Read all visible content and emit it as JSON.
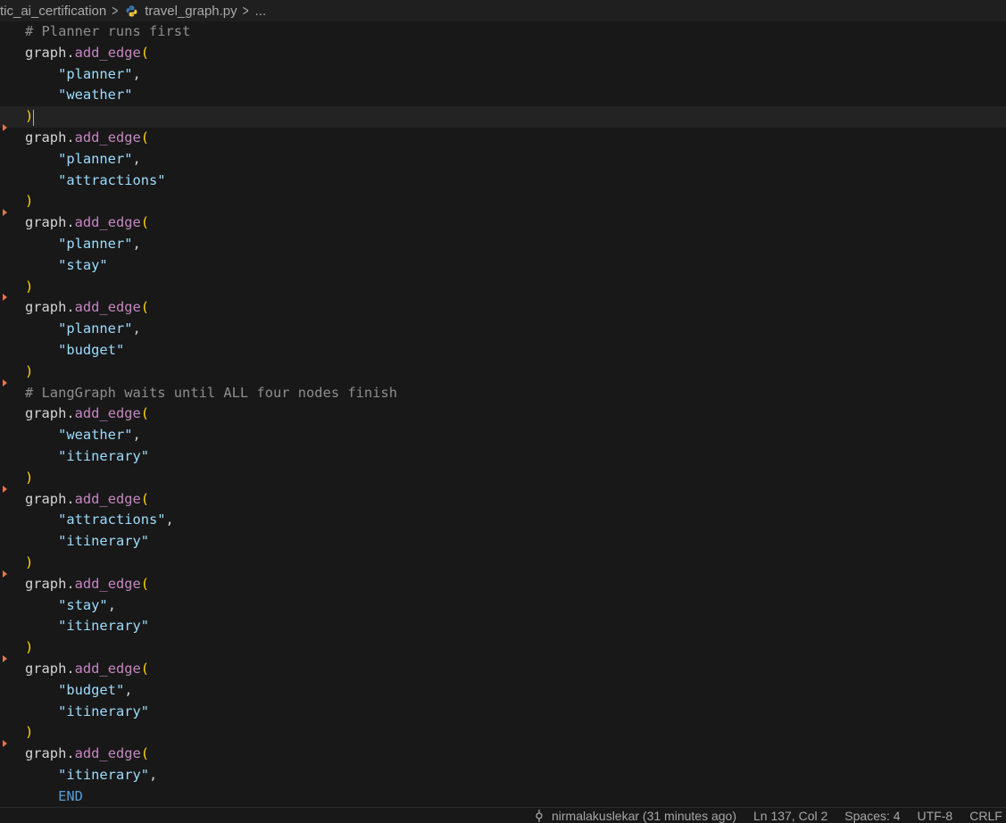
{
  "breadcrumb": {
    "folder": "tic_ai_certification",
    "file": "travel_graph.py",
    "more": "...",
    "file_icon": "python-icon",
    "separator_icon": "chevron-right-icon"
  },
  "editor": {
    "lines": [
      {
        "fold_arrow": false,
        "tokens": [
          {
            "t": "comment",
            "v": "# Planner runs first"
          }
        ]
      },
      {
        "fold_arrow": false,
        "tokens": [
          {
            "t": "var",
            "v": "graph"
          },
          {
            "t": "punct",
            "v": "."
          },
          {
            "t": "func",
            "v": "add_edge"
          },
          {
            "t": "paren",
            "v": "("
          }
        ]
      },
      {
        "fold_arrow": false,
        "tokens": [
          {
            "t": "punct",
            "v": "    "
          },
          {
            "t": "str",
            "v": "\"planner\""
          },
          {
            "t": "punct",
            "v": ","
          }
        ]
      },
      {
        "fold_arrow": false,
        "tokens": [
          {
            "t": "punct",
            "v": "    "
          },
          {
            "t": "str",
            "v": "\"weather\""
          }
        ]
      },
      {
        "fold_arrow": false,
        "current": true,
        "tokens": [
          {
            "t": "paren",
            "v": ")"
          }
        ]
      },
      {
        "fold_arrow": true,
        "tokens": [
          {
            "t": "var",
            "v": "graph"
          },
          {
            "t": "punct",
            "v": "."
          },
          {
            "t": "func",
            "v": "add_edge"
          },
          {
            "t": "paren",
            "v": "("
          }
        ]
      },
      {
        "fold_arrow": false,
        "tokens": [
          {
            "t": "punct",
            "v": "    "
          },
          {
            "t": "str",
            "v": "\"planner\""
          },
          {
            "t": "punct",
            "v": ","
          }
        ]
      },
      {
        "fold_arrow": false,
        "tokens": [
          {
            "t": "punct",
            "v": "    "
          },
          {
            "t": "str",
            "v": "\"attractions\""
          }
        ]
      },
      {
        "fold_arrow": false,
        "tokens": [
          {
            "t": "paren",
            "v": ")"
          }
        ]
      },
      {
        "fold_arrow": true,
        "tokens": [
          {
            "t": "var",
            "v": "graph"
          },
          {
            "t": "punct",
            "v": "."
          },
          {
            "t": "func",
            "v": "add_edge"
          },
          {
            "t": "paren",
            "v": "("
          }
        ]
      },
      {
        "fold_arrow": false,
        "tokens": [
          {
            "t": "punct",
            "v": "    "
          },
          {
            "t": "str",
            "v": "\"planner\""
          },
          {
            "t": "punct",
            "v": ","
          }
        ]
      },
      {
        "fold_arrow": false,
        "tokens": [
          {
            "t": "punct",
            "v": "    "
          },
          {
            "t": "str",
            "v": "\"stay\""
          }
        ]
      },
      {
        "fold_arrow": false,
        "tokens": [
          {
            "t": "paren",
            "v": ")"
          }
        ]
      },
      {
        "fold_arrow": true,
        "tokens": [
          {
            "t": "var",
            "v": "graph"
          },
          {
            "t": "punct",
            "v": "."
          },
          {
            "t": "func",
            "v": "add_edge"
          },
          {
            "t": "paren",
            "v": "("
          }
        ]
      },
      {
        "fold_arrow": false,
        "tokens": [
          {
            "t": "punct",
            "v": "    "
          },
          {
            "t": "str",
            "v": "\"planner\""
          },
          {
            "t": "punct",
            "v": ","
          }
        ]
      },
      {
        "fold_arrow": false,
        "tokens": [
          {
            "t": "punct",
            "v": "    "
          },
          {
            "t": "str",
            "v": "\"budget\""
          }
        ]
      },
      {
        "fold_arrow": false,
        "tokens": [
          {
            "t": "paren",
            "v": ")"
          }
        ]
      },
      {
        "fold_arrow": true,
        "tokens": [
          {
            "t": "comment",
            "v": "# LangGraph waits until ALL four nodes finish"
          }
        ]
      },
      {
        "fold_arrow": false,
        "tokens": [
          {
            "t": "var",
            "v": "graph"
          },
          {
            "t": "punct",
            "v": "."
          },
          {
            "t": "func",
            "v": "add_edge"
          },
          {
            "t": "paren",
            "v": "("
          }
        ]
      },
      {
        "fold_arrow": false,
        "tokens": [
          {
            "t": "punct",
            "v": "    "
          },
          {
            "t": "str",
            "v": "\"weather\""
          },
          {
            "t": "punct",
            "v": ","
          }
        ]
      },
      {
        "fold_arrow": false,
        "tokens": [
          {
            "t": "punct",
            "v": "    "
          },
          {
            "t": "str",
            "v": "\"itinerary\""
          }
        ]
      },
      {
        "fold_arrow": false,
        "tokens": [
          {
            "t": "paren",
            "v": ")"
          }
        ]
      },
      {
        "fold_arrow": true,
        "tokens": [
          {
            "t": "var",
            "v": "graph"
          },
          {
            "t": "punct",
            "v": "."
          },
          {
            "t": "func",
            "v": "add_edge"
          },
          {
            "t": "paren",
            "v": "("
          }
        ]
      },
      {
        "fold_arrow": false,
        "tokens": [
          {
            "t": "punct",
            "v": "    "
          },
          {
            "t": "str",
            "v": "\"attractions\""
          },
          {
            "t": "punct",
            "v": ","
          }
        ]
      },
      {
        "fold_arrow": false,
        "tokens": [
          {
            "t": "punct",
            "v": "    "
          },
          {
            "t": "str",
            "v": "\"itinerary\""
          }
        ]
      },
      {
        "fold_arrow": false,
        "tokens": [
          {
            "t": "paren",
            "v": ")"
          }
        ]
      },
      {
        "fold_arrow": true,
        "tokens": [
          {
            "t": "var",
            "v": "graph"
          },
          {
            "t": "punct",
            "v": "."
          },
          {
            "t": "func",
            "v": "add_edge"
          },
          {
            "t": "paren",
            "v": "("
          }
        ]
      },
      {
        "fold_arrow": false,
        "tokens": [
          {
            "t": "punct",
            "v": "    "
          },
          {
            "t": "str",
            "v": "\"stay\""
          },
          {
            "t": "punct",
            "v": ","
          }
        ]
      },
      {
        "fold_arrow": false,
        "tokens": [
          {
            "t": "punct",
            "v": "    "
          },
          {
            "t": "str",
            "v": "\"itinerary\""
          }
        ]
      },
      {
        "fold_arrow": false,
        "tokens": [
          {
            "t": "paren",
            "v": ")"
          }
        ]
      },
      {
        "fold_arrow": true,
        "tokens": [
          {
            "t": "var",
            "v": "graph"
          },
          {
            "t": "punct",
            "v": "."
          },
          {
            "t": "func",
            "v": "add_edge"
          },
          {
            "t": "paren",
            "v": "("
          }
        ]
      },
      {
        "fold_arrow": false,
        "tokens": [
          {
            "t": "punct",
            "v": "    "
          },
          {
            "t": "str",
            "v": "\"budget\""
          },
          {
            "t": "punct",
            "v": ","
          }
        ]
      },
      {
        "fold_arrow": false,
        "tokens": [
          {
            "t": "punct",
            "v": "    "
          },
          {
            "t": "str",
            "v": "\"itinerary\""
          }
        ]
      },
      {
        "fold_arrow": false,
        "tokens": [
          {
            "t": "paren",
            "v": ")"
          }
        ]
      },
      {
        "fold_arrow": true,
        "tokens": [
          {
            "t": "var",
            "v": "graph"
          },
          {
            "t": "punct",
            "v": "."
          },
          {
            "t": "func",
            "v": "add_edge"
          },
          {
            "t": "paren",
            "v": "("
          }
        ]
      },
      {
        "fold_arrow": false,
        "tokens": [
          {
            "t": "punct",
            "v": "    "
          },
          {
            "t": "str",
            "v": "\"itinerary\""
          },
          {
            "t": "punct",
            "v": ","
          }
        ]
      },
      {
        "fold_arrow": false,
        "tokens": [
          {
            "t": "punct",
            "v": "    "
          },
          {
            "t": "const",
            "v": "END"
          }
        ]
      }
    ]
  },
  "statusbar": {
    "blame": "nirmalakuslekar (31 minutes ago)",
    "blame_icon": "git-commit-icon",
    "position": "Ln 137, Col 2",
    "spaces": "Spaces: 4",
    "encoding": "UTF-8",
    "eol": "CRLF"
  },
  "colors": {
    "background": "#181818",
    "current_line": "#232323",
    "comment": "#8e8e8e",
    "function": "#c586c0",
    "bracket": "#ffd700",
    "string": "#9cdcfe",
    "constant": "#569cd6",
    "fold_arrow": "#e8734f"
  }
}
